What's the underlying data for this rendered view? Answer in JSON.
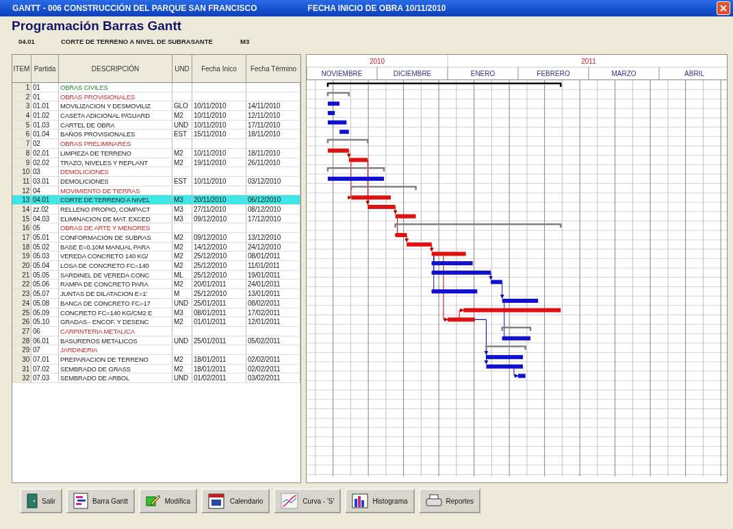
{
  "window": {
    "title": "GANTT  -  006 CONSTRUCCIÓN DEL PARQUE SAN FRANCISCO",
    "subtitle": "FECHA INICIO DE OBRA 10/11/2010"
  },
  "heading": "Programación Barras Gantt",
  "current": {
    "partida": "04.01",
    "descripcion": "CORTE DE TERRENO A NIVEL DE SUBRASANTE",
    "und": "M3"
  },
  "table": {
    "columns": [
      "ITEM",
      "Partida",
      "DESCRIPCIÓN",
      "UND",
      "Fecha Inico",
      "Fecha Término"
    ],
    "rows": [
      {
        "item": "1",
        "partida": "01",
        "descripcion": "OBRAS CIVILES",
        "kind": "project",
        "selected": false
      },
      {
        "item": "2",
        "partida": "01",
        "descripcion": "OBRAS PROVISIONALES",
        "kind": "group",
        "selected": false
      },
      {
        "item": "3",
        "partida": "01.01",
        "descripcion": "MOVILIZACION Y DESMOVILIZ",
        "und": "GLO",
        "inicio": "10/11/2010",
        "termino": "14/11/2010",
        "kind": "task",
        "critical": false,
        "selected": false
      },
      {
        "item": "4",
        "partida": "01.02",
        "descripcion": "CASETA ADICIONAL P/GUARD",
        "und": "M2",
        "inicio": "10/11/2010",
        "termino": "12/11/2010",
        "kind": "task",
        "critical": false,
        "selected": false
      },
      {
        "item": "5",
        "partida": "01.03",
        "descripcion": "CARTEL DE OBRA",
        "und": "UND",
        "inicio": "10/11/2010",
        "termino": "17/11/2010",
        "kind": "task",
        "critical": false,
        "selected": false
      },
      {
        "item": "6",
        "partida": "01.04",
        "descripcion": "BAÑOS PROVISIONALES",
        "und": "EST",
        "inicio": "15/11/2010",
        "termino": "18/11/2010",
        "kind": "task",
        "critical": false,
        "selected": false
      },
      {
        "item": "7",
        "partida": "02",
        "descripcion": "OBRAS PRELIMINARES",
        "kind": "group",
        "selected": false
      },
      {
        "item": "8",
        "partida": "02.01",
        "descripcion": "LIMPIEZA DE TERRENO",
        "und": "M2",
        "inicio": "10/11/2010",
        "termino": "18/11/2010",
        "kind": "task",
        "critical": true,
        "selected": false
      },
      {
        "item": "9",
        "partida": "02.02",
        "descripcion": "TRAZO, NIVELES Y REPLANT",
        "und": "M2",
        "inicio": "19/11/2010",
        "termino": "26/11/2010",
        "kind": "task",
        "critical": true,
        "selected": false
      },
      {
        "item": "10",
        "partida": "03",
        "descripcion": "DEMOLICIONES",
        "kind": "group",
        "selected": false
      },
      {
        "item": "11",
        "partida": "03.01",
        "descripcion": "DEMOLICIONES",
        "und": "EST",
        "inicio": "10/11/2010",
        "termino": "03/12/2010",
        "kind": "task",
        "critical": false,
        "selected": false
      },
      {
        "item": "12",
        "partida": "04",
        "descripcion": "MOVIMIENTO DE TIERRAS",
        "kind": "group",
        "selected": false
      },
      {
        "item": "13",
        "partida": "04.01",
        "descripcion": "CORTE DE TERRENO A NIVEL",
        "und": "M3",
        "inicio": "20/11/2010",
        "termino": "06/12/2010",
        "kind": "task",
        "critical": true,
        "selected": true
      },
      {
        "item": "14",
        "partida": "zz.02",
        "descripcion": "RELLENO PROPIO, COMPACT",
        "und": "M3",
        "inicio": "27/11/2010",
        "termino": "08/12/2010",
        "kind": "task",
        "critical": true,
        "selected": false
      },
      {
        "item": "15",
        "partida": "04.03",
        "descripcion": "ELIMINACION DE MAT. EXCED",
        "und": "M3",
        "inicio": "09/12/2010",
        "termino": "17/12/2010",
        "kind": "task",
        "critical": true,
        "selected": false
      },
      {
        "item": "16",
        "partida": "05",
        "descripcion": "OBRAS DE ARTE Y MENORES",
        "kind": "group",
        "selected": false
      },
      {
        "item": "17",
        "partida": "05.01",
        "descripcion": "CONFORMACION DE SUBRAS",
        "und": "M2",
        "inicio": "09/12/2010",
        "termino": "13/12/2010",
        "kind": "task",
        "critical": true,
        "selected": false
      },
      {
        "item": "18",
        "partida": "05.02",
        "descripcion": "BASE E=0.10M MANUAL PARA",
        "und": "M2",
        "inicio": "14/12/2010",
        "termino": "24/12/2010",
        "kind": "task",
        "critical": true,
        "selected": false
      },
      {
        "item": "19",
        "partida": "05.03",
        "descripcion": "VEREDA CONCRETO 140 KG/",
        "und": "M2",
        "inicio": "25/12/2010",
        "termino": "08/01/2011",
        "kind": "task",
        "critical": true,
        "selected": false
      },
      {
        "item": "20",
        "partida": "05.04",
        "descripcion": "LOSA DE CONCRETO FC=140",
        "und": "M2",
        "inicio": "25/12/2010",
        "termino": "11/01/2011",
        "kind": "task",
        "critical": false,
        "selected": false
      },
      {
        "item": "21",
        "partida": "05.05",
        "descripcion": "SARDINEL DE VEREDA CONC",
        "und": "ML",
        "inicio": "25/12/2010",
        "termino": "19/01/2011",
        "kind": "task",
        "critical": false,
        "selected": false
      },
      {
        "item": "22",
        "partida": "05.06",
        "descripcion": "RAMPA DE CONCRETO PARA",
        "und": "M2",
        "inicio": "20/01/2011",
        "termino": "24/01/2011",
        "kind": "task",
        "critical": false,
        "selected": false
      },
      {
        "item": "23",
        "partida": "05.07",
        "descripcion": "JUNTAS DE DILATACION E=1'",
        "und": "M",
        "inicio": "25/12/2010",
        "termino": "13/01/2011",
        "kind": "task",
        "critical": false,
        "selected": false
      },
      {
        "item": "24",
        "partida": "05.08",
        "descripcion": "BANCA DE CONCRETO FC=17",
        "und": "UND",
        "inicio": "25/01/2011",
        "termino": "08/02/2011",
        "kind": "task",
        "critical": false,
        "selected": false
      },
      {
        "item": "25",
        "partida": "05.09",
        "descripcion": "CONCRETO FC=140 KG/CM2 E",
        "und": "M3",
        "inicio": "08/01/2011",
        "termino": "17/02/2011",
        "kind": "task",
        "critical": true,
        "selected": false
      },
      {
        "item": "26",
        "partida": "05.10",
        "descripcion": "GRADAS.- ENCOF. Y DESENC",
        "und": "M2",
        "inicio": "01/01/2011",
        "termino": "12/01/2011",
        "kind": "task",
        "critical": true,
        "selected": false
      },
      {
        "item": "27",
        "partida": "06",
        "descripcion": "CARPINTERIA METALICA",
        "kind": "group",
        "selected": false
      },
      {
        "item": "28",
        "partida": "06.01",
        "descripcion": "BASUREROS METALICOS",
        "und": "UND",
        "inicio": "25/01/2011",
        "termino": "05/02/2011",
        "kind": "task",
        "critical": false,
        "selected": false
      },
      {
        "item": "29",
        "partida": "07",
        "descripcion": "JARDINERIA",
        "kind": "group",
        "selected": false
      },
      {
        "item": "30",
        "partida": "07.01",
        "descripcion": "PREPARACION DE TERRENO",
        "und": "M2",
        "inicio": "18/01/2011",
        "termino": "02/02/2011",
        "kind": "task",
        "critical": false,
        "selected": false
      },
      {
        "item": "31",
        "partida": "07.02",
        "descripcion": "SEMBRADO DE GRASS",
        "und": "M2",
        "inicio": "18/01/2011",
        "termino": "02/02/2011",
        "kind": "task",
        "critical": false,
        "selected": false
      },
      {
        "item": "32",
        "partida": "07.03",
        "descripcion": "SEMBRADO DE ARBOL",
        "und": "UND",
        "inicio": "01/02/2011",
        "termino": "03/02/2011",
        "kind": "task",
        "critical": false,
        "selected": false
      }
    ]
  },
  "gantt": {
    "years": [
      {
        "label": "2010",
        "months": [
          "NOVIEMBRE",
          "DICIEMBRE"
        ]
      },
      {
        "label": "2011",
        "months": [
          "ENERO",
          "FEBRERO",
          "MARZO",
          "ABRIL"
        ]
      }
    ]
  },
  "buttons": [
    {
      "label": "Salir",
      "kind": "exit"
    },
    {
      "label": "Barra Gantt",
      "kind": "gantt"
    },
    {
      "label": "Modifica",
      "kind": "edit"
    },
    {
      "label": "Calendario",
      "kind": "calendar"
    },
    {
      "label": "Curva - 'S'",
      "kind": "curve"
    },
    {
      "label": "Histograma",
      "kind": "histogram"
    },
    {
      "label": "Reportes",
      "kind": "reports"
    }
  ]
}
